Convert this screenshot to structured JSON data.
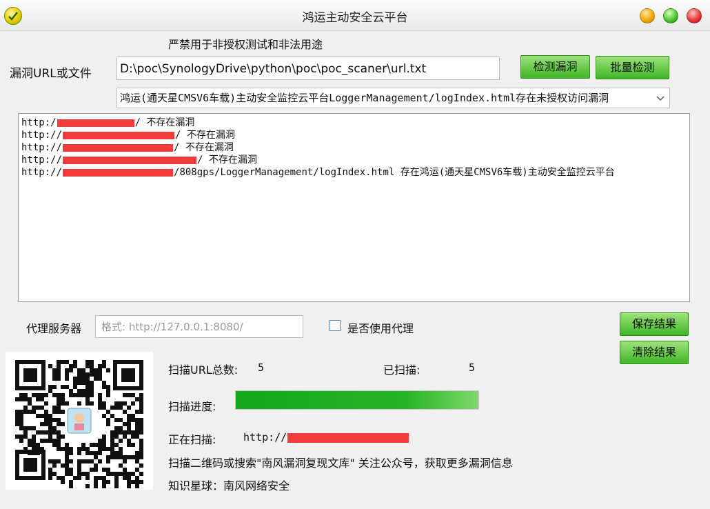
{
  "window": {
    "title": "鸿运主动安全云平台"
  },
  "warning": "严禁用于非授权测试和非法用途",
  "url_section": {
    "label": "漏洞URL或文件",
    "value": "D:\\poc\\SynologyDrive\\python\\poc\\poc_scaner\\url.txt",
    "check_button": "检测漏洞",
    "batch_button": "批量检测"
  },
  "poc_select": {
    "selected": "鸿运(通天星CMSV6车载)主动安全监控云平台LoggerManagement/logIndex.html存在未授权访问漏洞"
  },
  "results": {
    "lines": [
      {
        "prefix": "http:/",
        "redact_width": 112,
        "suffix": "/  不存在漏洞"
      },
      {
        "prefix": "http://",
        "redact_width": 162,
        "suffix": "/  不存在漏洞"
      },
      {
        "prefix": "http://",
        "redact_width": 160,
        "suffix": "/  不存在漏洞"
      },
      {
        "prefix": "http://",
        "redact_width": 194,
        "suffix": "/  不存在漏洞"
      },
      {
        "prefix": "http://",
        "redact_width": 160,
        "suffix": "/808gps/LoggerManagement/logIndex.html  存在鸿运(通天星CMSV6车载)主动安全监控云平台"
      }
    ]
  },
  "proxy": {
    "label": "代理服务器",
    "placeholder": "格式: http://127.0.0.1:8080/",
    "use_proxy_label": "是否使用代理",
    "use_proxy_checked": false
  },
  "actions": {
    "save_label": "保存结果",
    "clear_label": "清除结果"
  },
  "scan": {
    "total_label": "扫描URL总数:",
    "total_value": "5",
    "scanned_label": "已扫描:",
    "scanned_value": "5",
    "progress_label": "扫描进度:",
    "progress_percent": 100,
    "current_label": "正在扫描:",
    "current_value": "http://"
  },
  "promo": {
    "line1": "扫描二维码或搜索\"南风漏洞复现文库\"  关注公众号，获取更多漏洞信息",
    "line2": "知识星球：南风网络安全"
  },
  "colors": {
    "button_green": "#3fb726",
    "redaction_red": "#f23b3b",
    "progress_green": "#14a61d"
  }
}
